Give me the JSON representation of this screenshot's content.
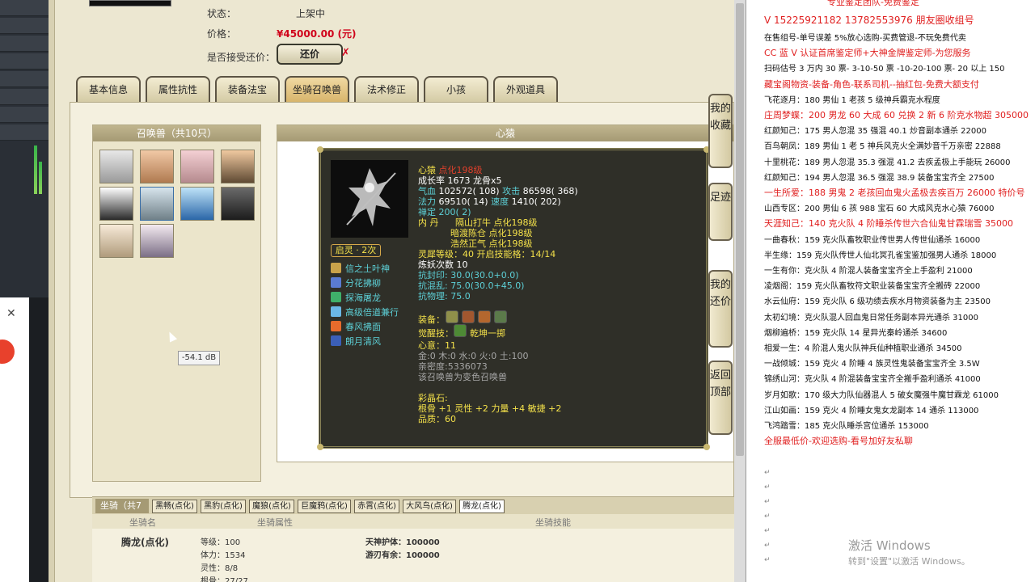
{
  "listing": {
    "status_label": "状态：",
    "status_value": "上架中",
    "price_label": "价格：",
    "price_value": "¥45000.00 (元)",
    "bargain_label": "是否接受还价：",
    "bargain_button": "还价",
    "bargain_mark": "✗"
  },
  "tabs": [
    "基本信息",
    "属性抗性",
    "装备法宝",
    "坐骑召唤兽",
    "法术修正",
    "小孩",
    "外观道具"
  ],
  "summon_panel_title": "召唤兽（共10只）",
  "detail_title": "心猿",
  "pet": {
    "name": "心猿",
    "name_suffix": "点化198级",
    "growth": "成长率 1673 龙骨x5",
    "hp_label": "气血",
    "hp_value": "102572( 108)",
    "atk_label": "攻击",
    "atk_value": "86598( 368)",
    "mp_label": "法力",
    "mp_value": "69510( 14)",
    "spd_label": "速度",
    "spd_value": "1410( 202)",
    "zen": "禅定 200( 2)",
    "dan_label": "内 丹",
    "dan_1": "隔山打牛 点化198级",
    "dan_2": "暗渡陈仓 点化198级",
    "dan_3": "浩然正气 点化198级",
    "awaken_badge": "启灵 · 2次",
    "skills": [
      "信之土叶神",
      "分花拂柳",
      "探海屠龙",
      "高级倍道兼行",
      "春风拂面",
      "朗月清风"
    ],
    "lingxi_level": "灵犀等级：40 开启技能格：14/14",
    "refine": "炼妖次数 10",
    "resist_seal": "抗封印: 30.0(30.0+0.0)",
    "resist_chaos": "抗混乱: 75.0(30.0+45.0)",
    "resist_phys": "抗物理: 75.0",
    "equip_label": "装备：",
    "awakening_label": "觉醒技：",
    "awakening_value": "乾坤一掷",
    "heart": "心意：11",
    "elements": "金:0 木:0 水:0 火:0 土:100",
    "intimacy": "亲密度:5336073",
    "variant": "该召唤兽为变色召唤兽",
    "crystal_title": "彩晶石:",
    "crystal_stats": "根骨 +1 灵性 +2 力量 +4 敏捷 +2",
    "quality": "品质：60"
  },
  "side_buttons": [
    "我的收藏",
    "足迹",
    "我的还价",
    "返回顶部"
  ],
  "db_readout": "-54.1 dB",
  "mount": {
    "title": "坐骑（共7只",
    "tabs": [
      "黑畅(点化)",
      "黑豹(点化)",
      "魔狼(点化)",
      "巨魔鸦(点化)",
      "赤霄(点化)",
      "大风鸟(点化)",
      "腾龙(点化)"
    ],
    "col_name": "坐骑名",
    "col_attr": "坐骑属性",
    "col_skill": "坐骑技能",
    "name": "腾龙(点化)",
    "level": "等级：100",
    "stamina": "体力：1534",
    "spirit": "灵性：8/8",
    "bone": "根骨：27/27",
    "skill_1": "天神护体：100000",
    "skill_2": "游刃有余：100000"
  },
  "doc": {
    "top_line": "专业鉴定团队-免费鉴定",
    "contact": "V 15225921182  13782553976 朋友圈收组号",
    "lines": [
      {
        "text": "在售组号-单号误差 5%放心选购-买费管退-不玩免费代卖",
        "red": false
      },
      {
        "text": "CC 蓝 V 认证首席鉴定师+大神金牌鉴定师-为您服务",
        "red": true
      },
      {
        "text": "扫码估号 3 万内 30 票- 3-10-50 票  -10-20-100 票- 20 以上 150",
        "red": false
      },
      {
        "text": "藏宝阁物资-装备-角色-联系司机--抽红包-免费大额支付",
        "red": true
      },
      {
        "text": "飞花逐月：180 男仙 1 老孩 5 级神兵霸克水程度",
        "red": false
      },
      {
        "text": "庄周梦蝶：200 男龙 60 大成 60 兑换 2 新 6 阶克水物超 305000",
        "red": true
      },
      {
        "text": "红颜知己：175 男人忽混 35 强混 40.1 炒音副本通杀 22000",
        "red": false
      },
      {
        "text": "百鸟朝凤：189 男仙 1 老 5 神兵风克火全满妙音千万亲密 22888",
        "red": false
      },
      {
        "text": "十里桃花：189 男人忽混 35.3 强混 41.2 去疾孟极上手能玩 26000",
        "red": false
      },
      {
        "text": "红颜知己：194 男人忽混 36.5 强混 38.9 装备宝宝齐全 27500",
        "red": false
      },
      {
        "text": "一生所爱：188 男鬼 2 老孩回血鬼火孟极去疾百万 26000 特价号",
        "red": true
      },
      {
        "text": "山西专区：200 男仙 6 孩 988 宝石 60 大成风克水心猿 76000",
        "red": false
      },
      {
        "text": "天涯知己：140 克火队 4 阶睡杀传世六合仙鬼甘霖瑞雪 35000",
        "red": true
      },
      {
        "text": "一曲春秋：159 克火队畜牧职业传世男人传世仙通杀 16000",
        "red": false
      },
      {
        "text": "半生缘：159 克火队传世人仙北冥孔雀宝鉴加强男人通杀 18000",
        "red": false
      },
      {
        "text": "一生有你：克火队 4 阶混人装备宝宝齐全上手盈利 21000",
        "red": false
      },
      {
        "text": "凌烟阁：159 克火队畜牧符文职业装备宝宝齐全搬砖 22000",
        "red": false
      },
      {
        "text": "水云仙府：159 克火队 6 级功绩去疾水月物资装备为主 23500",
        "red": false
      },
      {
        "text": "太初幻境：克火队混人回血鬼日常任务副本异光通杀 31000",
        "red": false
      },
      {
        "text": "烟柳遍桥：159 克火队 14 星异光秦岭通杀 34600",
        "red": false
      },
      {
        "text": "相爱一生：4 阶混人鬼火队神兵仙种植职业通杀 34500",
        "red": false
      },
      {
        "text": "一战倾城：159 克火 4 阶睡 4 族灵性鬼装备宝宝齐全 3.5W",
        "red": false
      },
      {
        "text": "锦绣山河：克火队 4 阶混装备宝宝齐全搬手盈利通杀 41000",
        "red": false
      },
      {
        "text": "岁月如歌：170 级大力队仙器混人 5 破女魔强牛魔甘霖龙 61000",
        "red": false
      },
      {
        "text": "江山如画：159 克火 4 阶睡女鬼女龙副本 14 通杀 113000",
        "red": false
      },
      {
        "text": "飞鸿踏雪：185 克火队睡杀宫位通杀 153000",
        "red": false
      },
      {
        "text": "全服最低价-欢迎选购-看号加好友私聊",
        "red": true
      }
    ],
    "watermark_1": "激活 Windows",
    "watermark_2": "转到\"设置\"以激活 Windows。"
  },
  "colors": {
    "price_red": "#d0021b",
    "tooltip_bg": "#2f2f28",
    "doc_red": "#e02020",
    "skill_cyan": "#5dd1d8",
    "name_yellow": "#f4e14a"
  }
}
